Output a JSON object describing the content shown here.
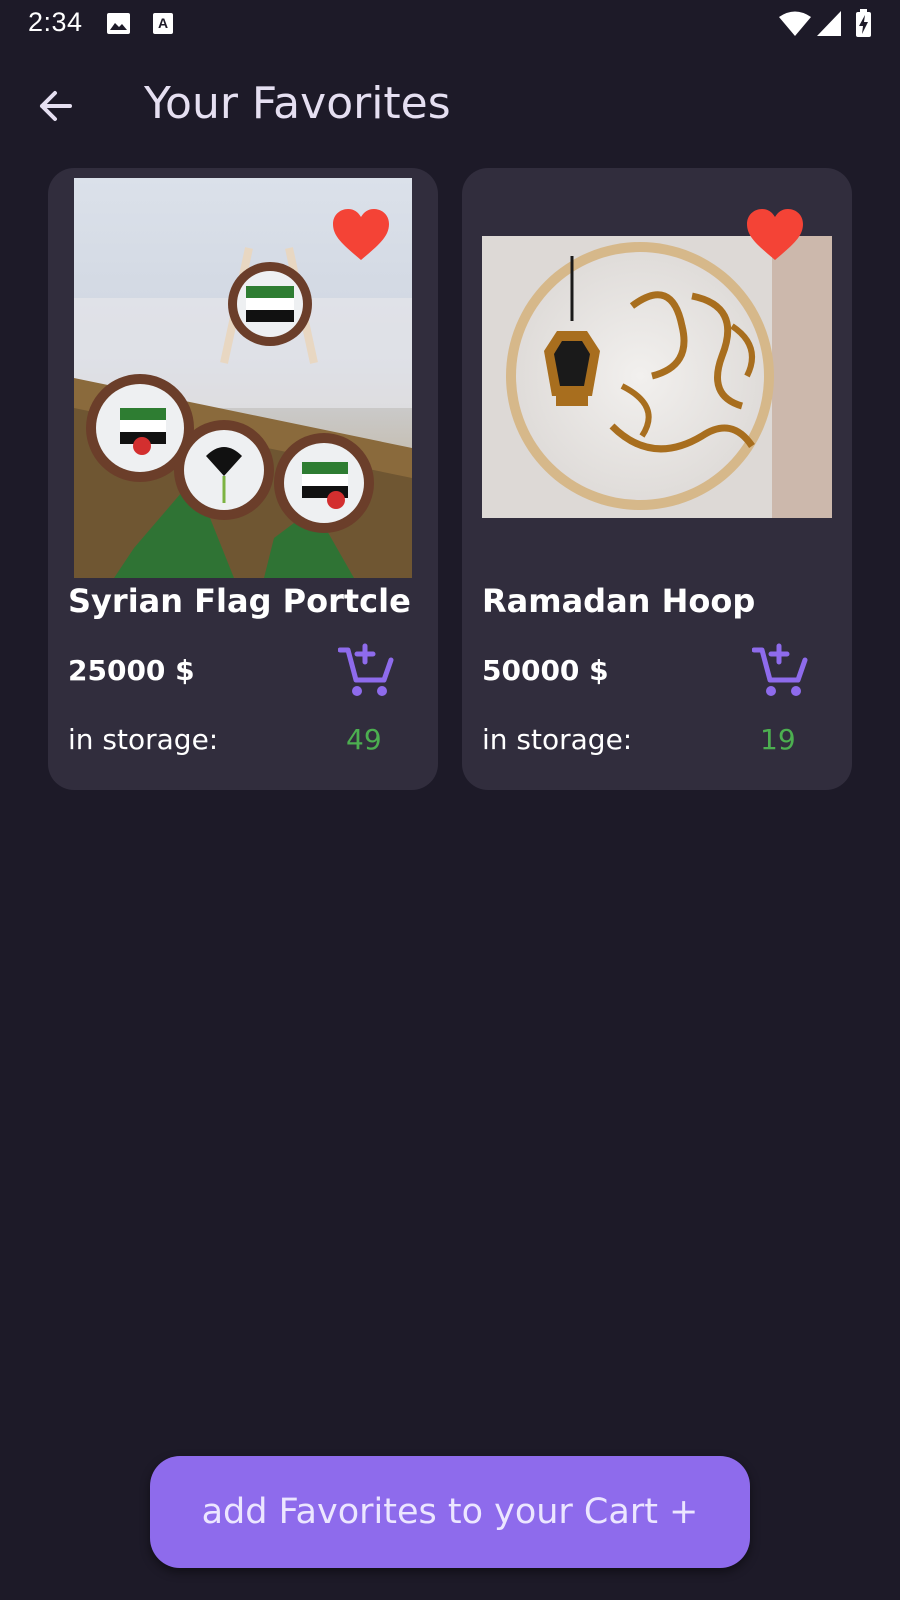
{
  "status_bar": {
    "time": "2:34",
    "icons": [
      "image-icon",
      "font-download-icon",
      "wifi-icon",
      "cellular-signal-icon",
      "battery-charging-icon"
    ]
  },
  "app_bar": {
    "title": "Your Favorites",
    "back_icon": "arrow-back-icon"
  },
  "favorites": [
    {
      "name": "Syrian Flag Portcle",
      "price": "25000 $",
      "storage_label": "in storage:",
      "storage_count": "49",
      "favorite_icon": "heart-icon",
      "cart_icon": "add-shopping-cart-icon"
    },
    {
      "name": "Ramadan Hoop",
      "price": "50000 $",
      "storage_label": "in storage:",
      "storage_count": "19",
      "favorite_icon": "heart-icon",
      "cart_icon": "add-shopping-cart-icon"
    }
  ],
  "actions": {
    "add_to_cart_label": "add Favorites to your Cart +"
  },
  "colors": {
    "background": "#1d1a28",
    "card": "#312d3d",
    "accent": "#8e6bec",
    "heart": "#f44336",
    "stock": "#4caf50",
    "title": "#e5dff1"
  }
}
